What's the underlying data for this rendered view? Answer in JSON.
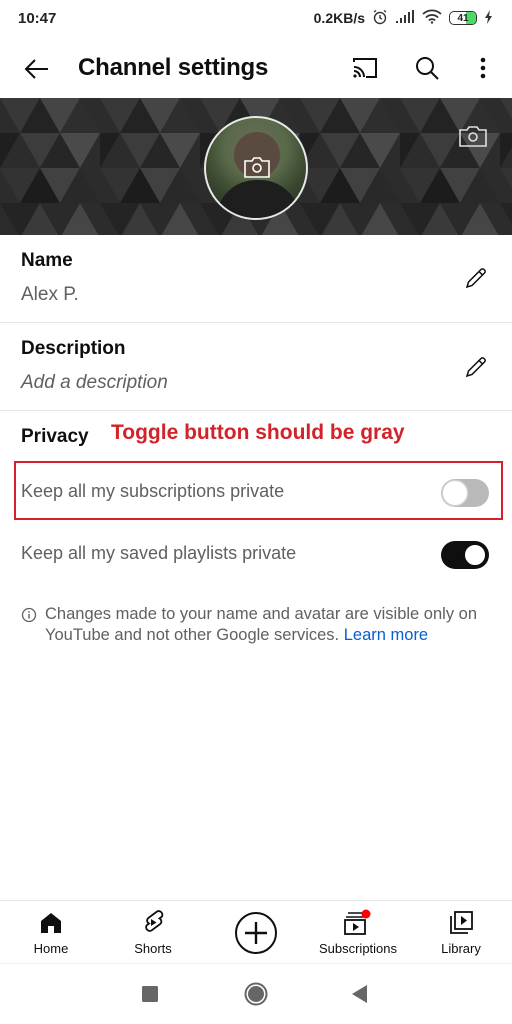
{
  "status_bar": {
    "time": "10:47",
    "network_speed": "0.2KB/s",
    "battery_level": "41",
    "icons": [
      "alarm-icon",
      "signal-icon",
      "wifi-icon",
      "battery-icon",
      "charging-icon"
    ]
  },
  "app_bar": {
    "title": "Channel settings",
    "icons": [
      "back-arrow-icon",
      "cast-icon",
      "search-icon",
      "more-vert-icon"
    ]
  },
  "banner": {
    "avatar_alt": "Channel avatar",
    "icons": [
      "camera-icon"
    ]
  },
  "fields": {
    "name": {
      "label": "Name",
      "value": "Alex P."
    },
    "description": {
      "label": "Description",
      "placeholder": "Add a description"
    }
  },
  "privacy": {
    "title": "Privacy",
    "annotation": "Toggle button should be gray",
    "annotation_color": "#d2232a",
    "options": [
      {
        "label": "Keep all my subscriptions private",
        "enabled": false
      },
      {
        "label": "Keep all my saved playlists private",
        "enabled": true
      }
    ]
  },
  "info": {
    "text": "Changes made to your name and avatar are visible only on YouTube and not other Google services.",
    "link": "Learn more",
    "link_color": "#065fd4"
  },
  "bottom_nav": {
    "items": [
      {
        "label": "Home",
        "icon": "home-icon"
      },
      {
        "label": "Shorts",
        "icon": "shorts-icon"
      },
      {
        "label": "",
        "icon": "create-plus-icon"
      },
      {
        "label": "Subscriptions",
        "icon": "subscriptions-icon",
        "badge": true
      },
      {
        "label": "Library",
        "icon": "library-icon"
      }
    ],
    "badge_color": "#ff0000"
  },
  "system_nav": {
    "buttons": [
      "recents-button",
      "home-button",
      "back-button"
    ]
  }
}
